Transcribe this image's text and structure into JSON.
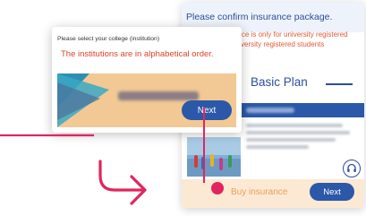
{
  "insurance_card": {
    "title": "Please confirm insurance package.",
    "notice_line1": "ervice is only for university registered",
    "notice_line2": "University registered students",
    "plan_name": "Basic Plan",
    "footer": {
      "buy_label": "Buy insurance",
      "next_label": "Next"
    },
    "support_icon": "headset-icon"
  },
  "college_card": {
    "hint": "Please select your college (institution)",
    "order_note": "The institutions are in alphabetical order.",
    "next_label": "Next"
  },
  "colors": {
    "accent_blue": "#2b58a8",
    "title_blue": "#2b4f99",
    "notice_red": "#e05a3a",
    "pointer_pink": "#e0255f",
    "footer_beige": "#fbe9d3",
    "banner_orange": "#f2c894"
  }
}
